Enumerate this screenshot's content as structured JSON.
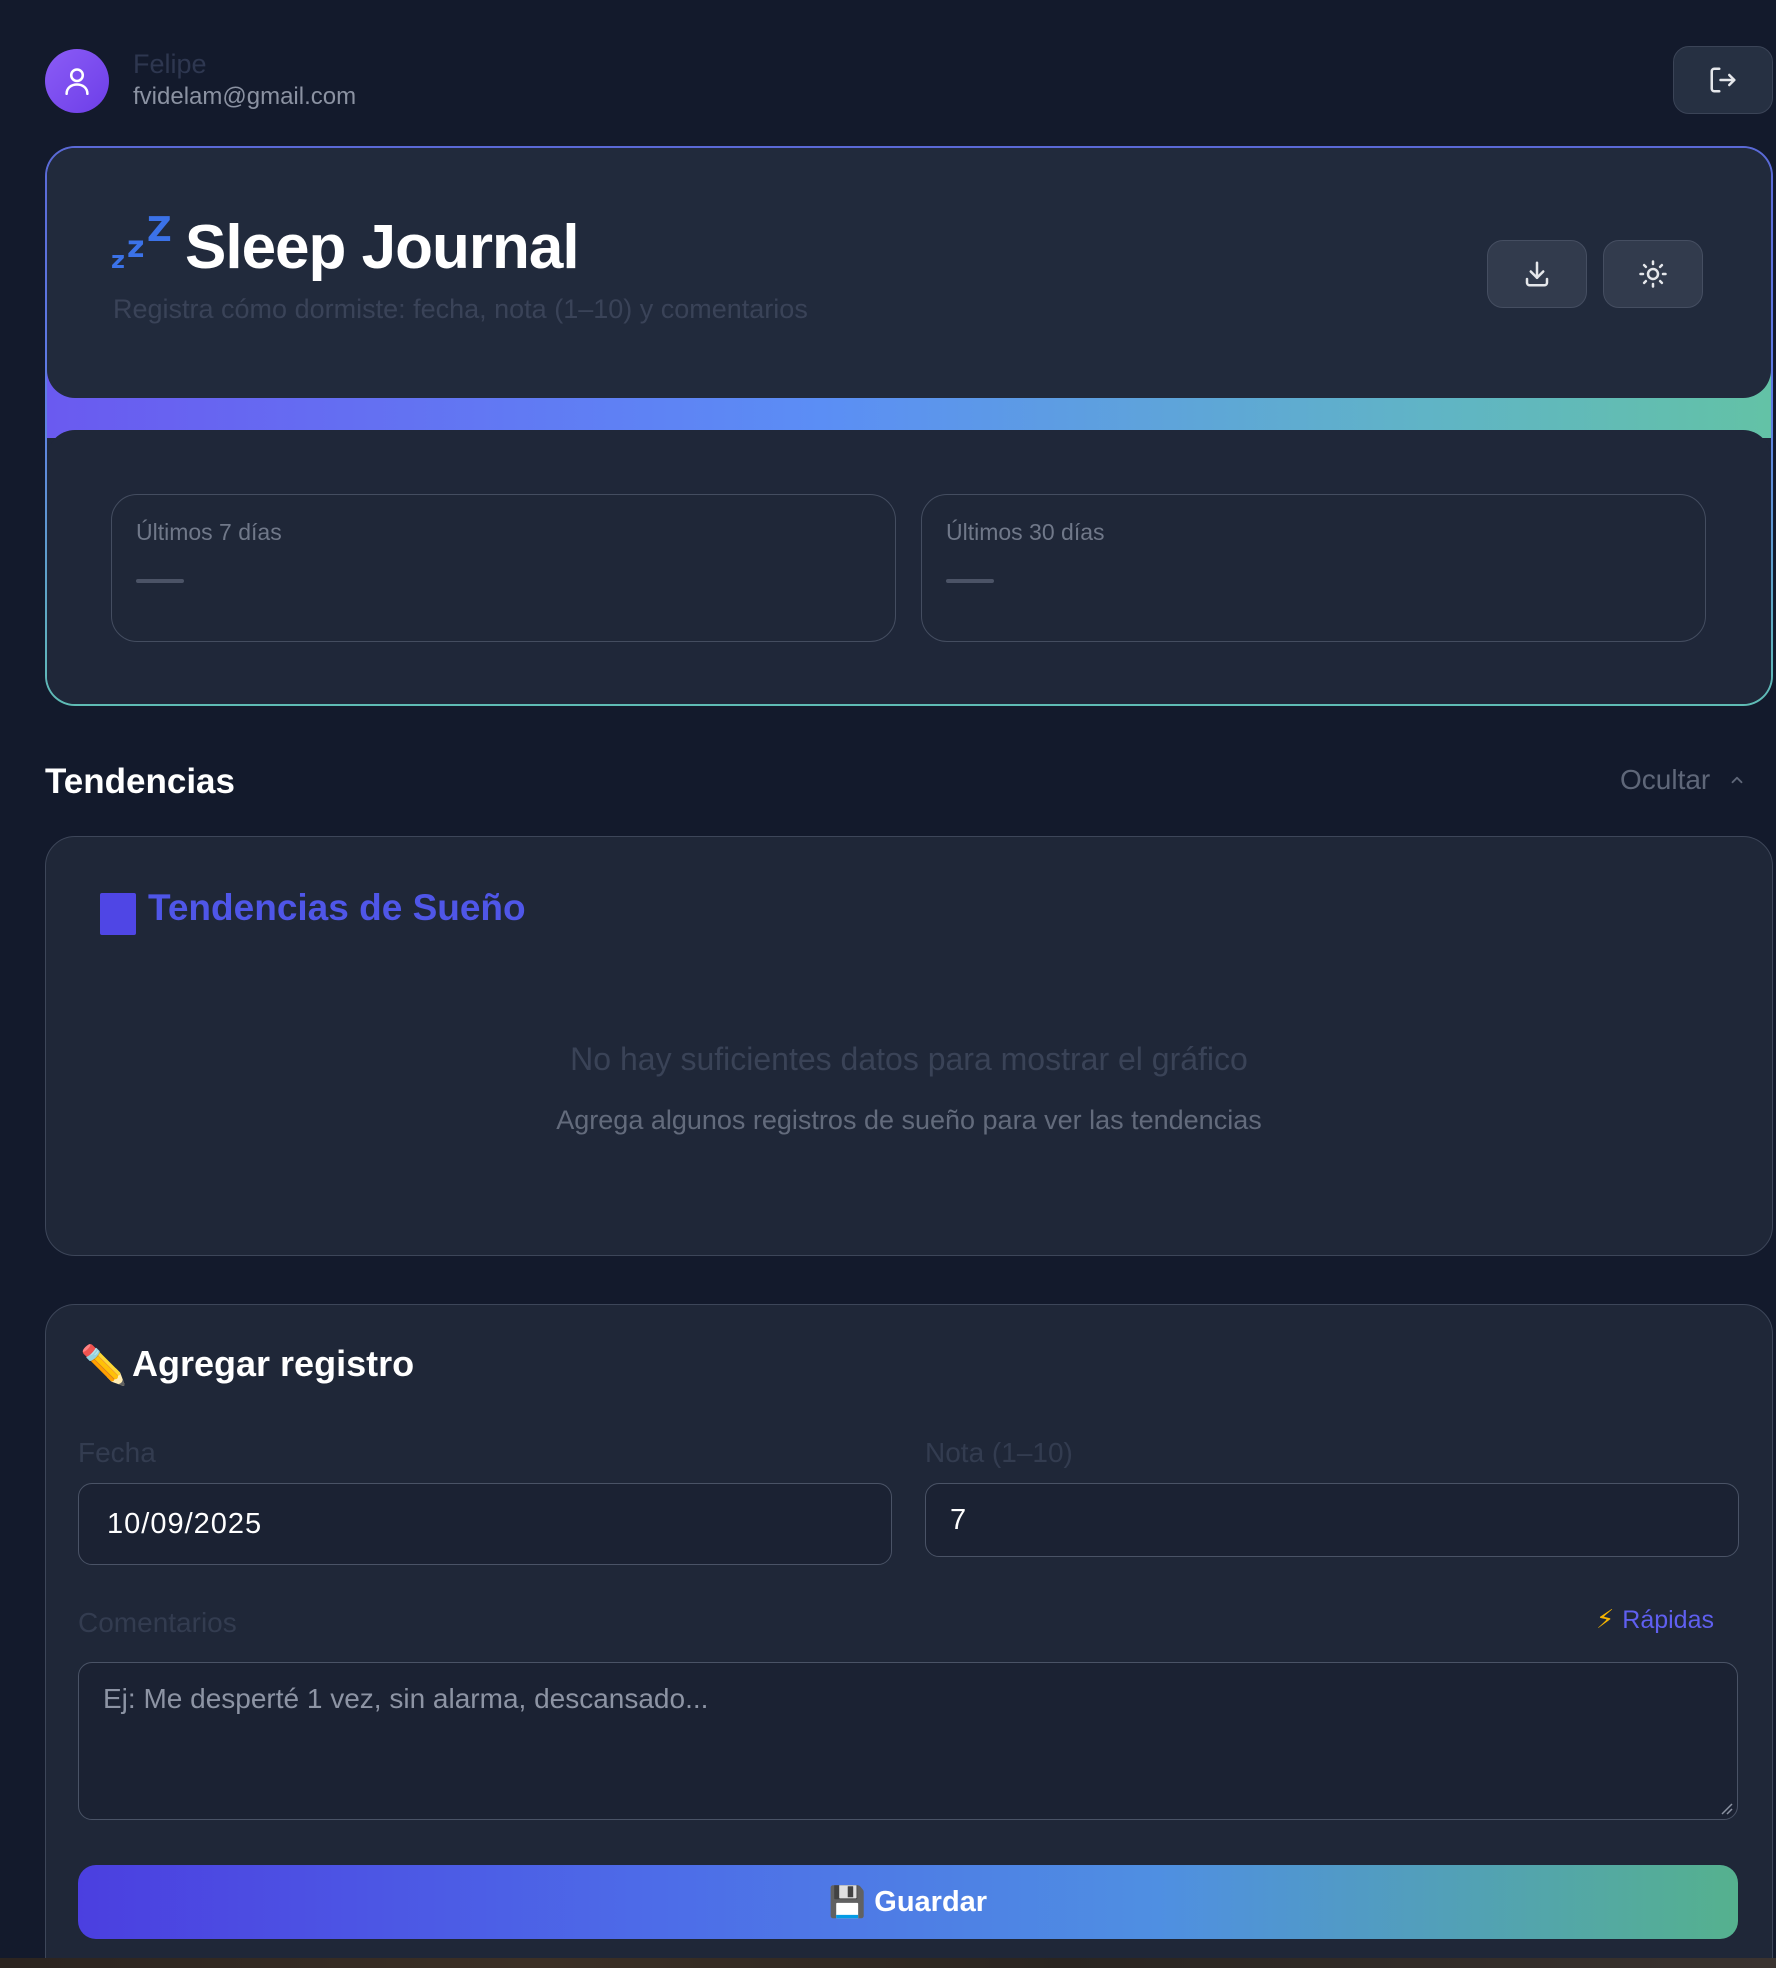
{
  "user": {
    "name": "Felipe",
    "email": "fvidelam@gmail.com"
  },
  "header": {
    "title": "Sleep Journal",
    "subtitle": "Registra cómo dormiste: fecha, nota (1–10) y comentarios",
    "icon": "zzz-icon"
  },
  "stats": [
    {
      "label": "Últimos 7 días",
      "value": ""
    },
    {
      "label": "Últimos 30 días",
      "value": ""
    }
  ],
  "trends": {
    "section_title": "Tendencias",
    "toggle_label": "Ocultar",
    "card_title": "Tendencias de Sueño",
    "empty_title": "No hay suficientes datos para mostrar el gráfico",
    "empty_subtitle": "Agrega algunos registros de sueño para ver las tendencias"
  },
  "form": {
    "title": "Agregar registro",
    "title_icon": "✏️",
    "date_label": "Fecha",
    "date_value": "10/09/2025",
    "score_label": "Nota (1–10)",
    "score_value": "7",
    "comments_label": "Comentarios",
    "comments_placeholder": "Ej: Me desperté 1 vez, sin alarma, descansado...",
    "quick_label": "Rápidas",
    "quick_icon": "⚡",
    "save_label": "Guardar",
    "save_icon": "💾"
  },
  "colors": {
    "background": "#131a2c",
    "card": "#1f2738",
    "accent_indigo": "#4f46e5",
    "accent_teal": "#55b18e",
    "avatar": "#8b5cf6"
  }
}
